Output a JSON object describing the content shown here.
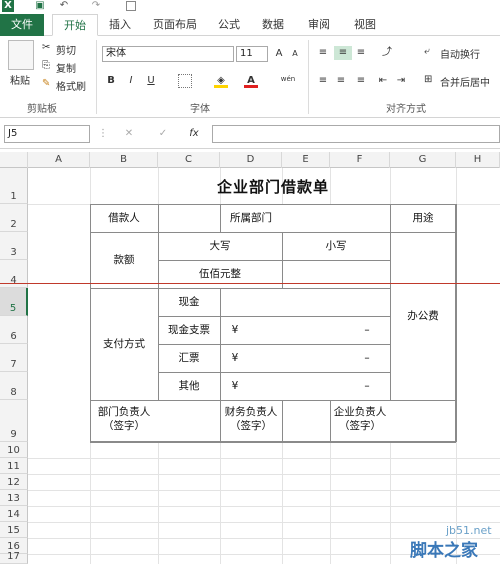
{
  "app": {
    "title_icons": [
      "excel-logo-icon",
      "save-icon",
      "undo-icon",
      "redo-icon",
      "print-preview-icon"
    ]
  },
  "tabs": [
    "文件",
    "开始",
    "插入",
    "页面布局",
    "公式",
    "数据",
    "审阅",
    "视图"
  ],
  "ribbon": {
    "clipboard": {
      "paste": "粘贴",
      "cut": "剪切",
      "copy": "复制",
      "format_painter": "格式刷",
      "label": "剪贴板"
    },
    "font": {
      "name": "宋体",
      "size": "11",
      "bold": "B",
      "italic": "I",
      "underline": "U",
      "phonetic": "wén",
      "label": "字体"
    },
    "alignment": {
      "wrap": "自动换行",
      "merge": "合并后居中",
      "label": "对齐方式"
    }
  },
  "formula_bar": {
    "name_box": "J5",
    "fx": "fx",
    "value": ""
  },
  "columns": [
    "A",
    "B",
    "C",
    "D",
    "E",
    "F",
    "G",
    "H"
  ],
  "rows": [
    "1",
    "2",
    "3",
    "4",
    "5",
    "6",
    "7",
    "8",
    "9",
    "10",
    "11",
    "12",
    "13",
    "14",
    "15",
    "16",
    "17"
  ],
  "form": {
    "title": "企业部门借款单",
    "borrower": "借款人",
    "department": "所属部门",
    "purpose": "用途",
    "amount": "款额",
    "upper": "大写",
    "lower": "小写",
    "upper_value": "伍佰元整",
    "payment_method": "支付方式",
    "cash": "现金",
    "check": "现金支票",
    "draft": "汇票",
    "other": "其他",
    "yen1": "¥",
    "dash1": "–",
    "yen2": "¥",
    "dash2": "–",
    "yen3": "¥",
    "dash3": "–",
    "purpose_value": "办公费",
    "sign1a": "部门负责人",
    "sign1b": "（签字）",
    "sign2a": "财务负责人",
    "sign2b": "（签字）",
    "sign3a": "企业负责人",
    "sign3b": "（签字）"
  },
  "watermark": {
    "site": "jb51.net",
    "name": "脚本之家"
  },
  "colors": {
    "accent": "#217346",
    "page_break": "#c0392b"
  }
}
